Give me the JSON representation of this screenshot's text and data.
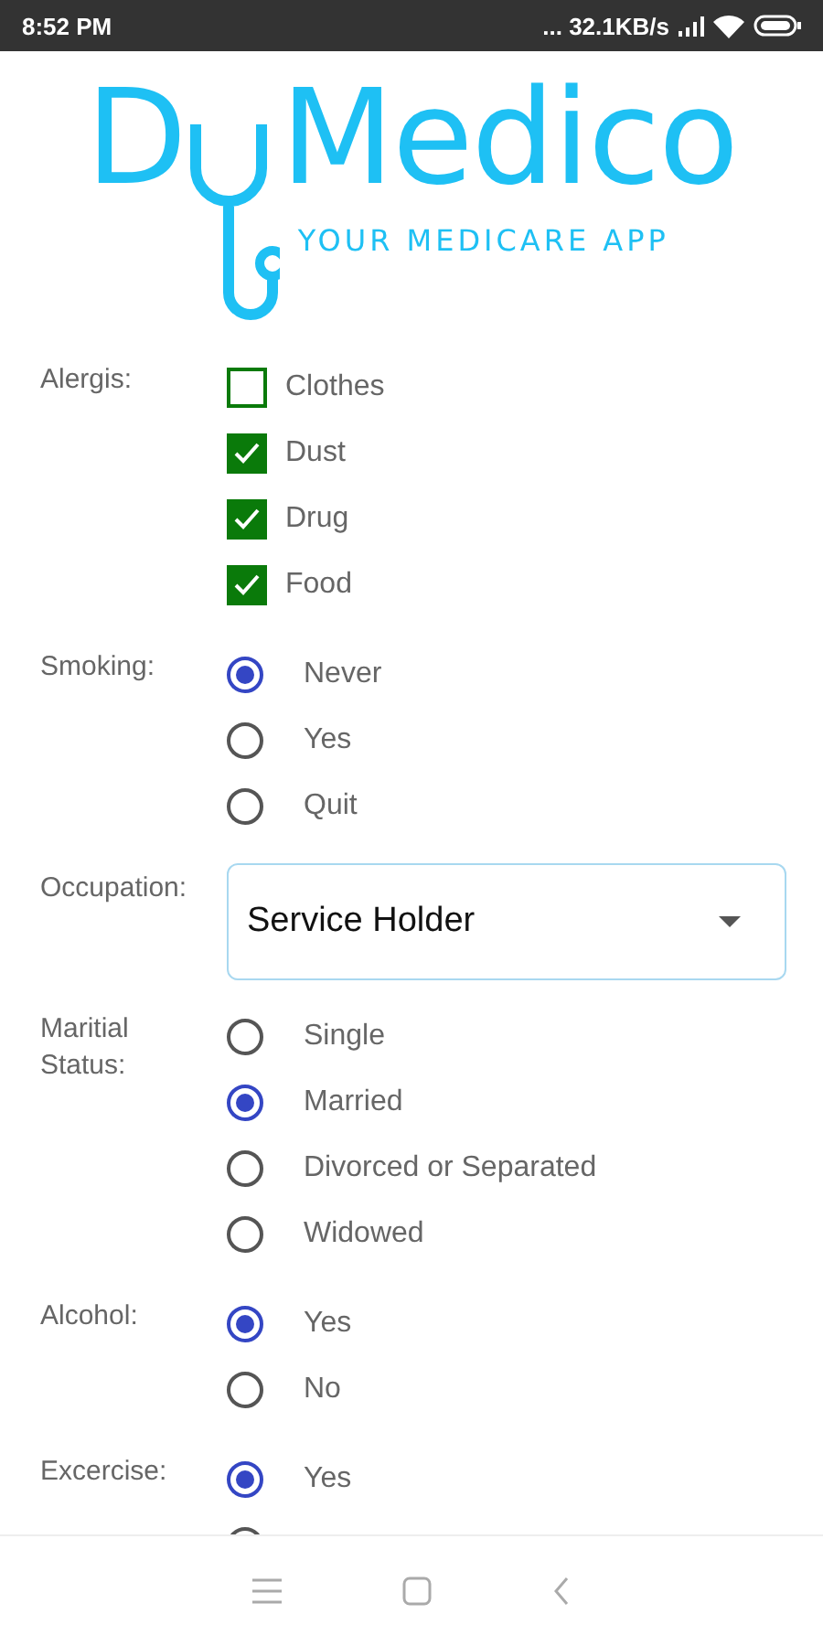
{
  "status_bar": {
    "time": "8:52 PM",
    "network_speed": "... 32.1KB/s"
  },
  "logo": {
    "initial": "D",
    "name": "Medico",
    "tagline": "YOUR MEDICARE APP"
  },
  "form": [
    {
      "kind": "checkboxes",
      "label": "Alergis:",
      "options": [
        {
          "label": "Clothes",
          "checked": false
        },
        {
          "label": "Dust",
          "checked": true
        },
        {
          "label": "Drug",
          "checked": true
        },
        {
          "label": "Food",
          "checked": true
        }
      ]
    },
    {
      "kind": "radios",
      "label": "Smoking:",
      "options": [
        {
          "label": "Never",
          "selected": true
        },
        {
          "label": "Yes",
          "selected": false
        },
        {
          "label": "Quit",
          "selected": false
        }
      ]
    },
    {
      "kind": "dropdown",
      "label": "Occupation:",
      "value": "Service Holder"
    },
    {
      "kind": "radios",
      "label": "Maritial Status:",
      "options": [
        {
          "label": "Single",
          "selected": false
        },
        {
          "label": "Married",
          "selected": true
        },
        {
          "label": "Divorced or Separated",
          "selected": false
        },
        {
          "label": "Widowed",
          "selected": false
        }
      ]
    },
    {
      "kind": "radios",
      "label": "Alcohol:",
      "options": [
        {
          "label": "Yes",
          "selected": true
        },
        {
          "label": "No",
          "selected": false
        }
      ]
    },
    {
      "kind": "radios",
      "label": "Excercise:",
      "options": [
        {
          "label": "Yes",
          "selected": true
        },
        {
          "selected": false
        }
      ]
    }
  ]
}
